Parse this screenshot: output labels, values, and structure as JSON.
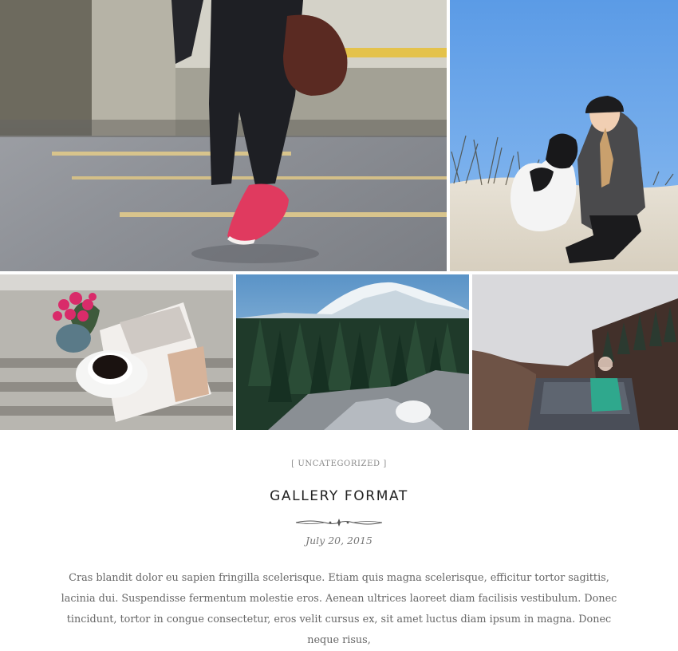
{
  "gallery": {
    "images": [
      {
        "alt": "person walking in pink sneakers"
      },
      {
        "alt": "woman with dog on beach"
      },
      {
        "alt": "coffee cup and magazine"
      },
      {
        "alt": "snowy mountain forest"
      },
      {
        "alt": "person by mountain lake"
      }
    ]
  },
  "post": {
    "category": "[ UNCATEGORIZED ]",
    "title": "GALLERY FORMAT",
    "date": "July 20, 2015",
    "excerpt": "Cras blandit dolor eu sapien fringilla scelerisque. Etiam quis magna scelerisque, efficitur tortor sagittis, lacinia dui. Suspendisse fermentum molestie eros. Aenean ultrices laoreet diam facilisis vestibulum. Donec tincidunt, tortor in congue consectetur, eros velit cursus ex, sit amet luctus diam ipsum in magna. Donec neque risus,"
  },
  "colors": {
    "background": "#ffffff",
    "title": "#222222",
    "text": "#666666",
    "muted": "#8a8a8a"
  }
}
